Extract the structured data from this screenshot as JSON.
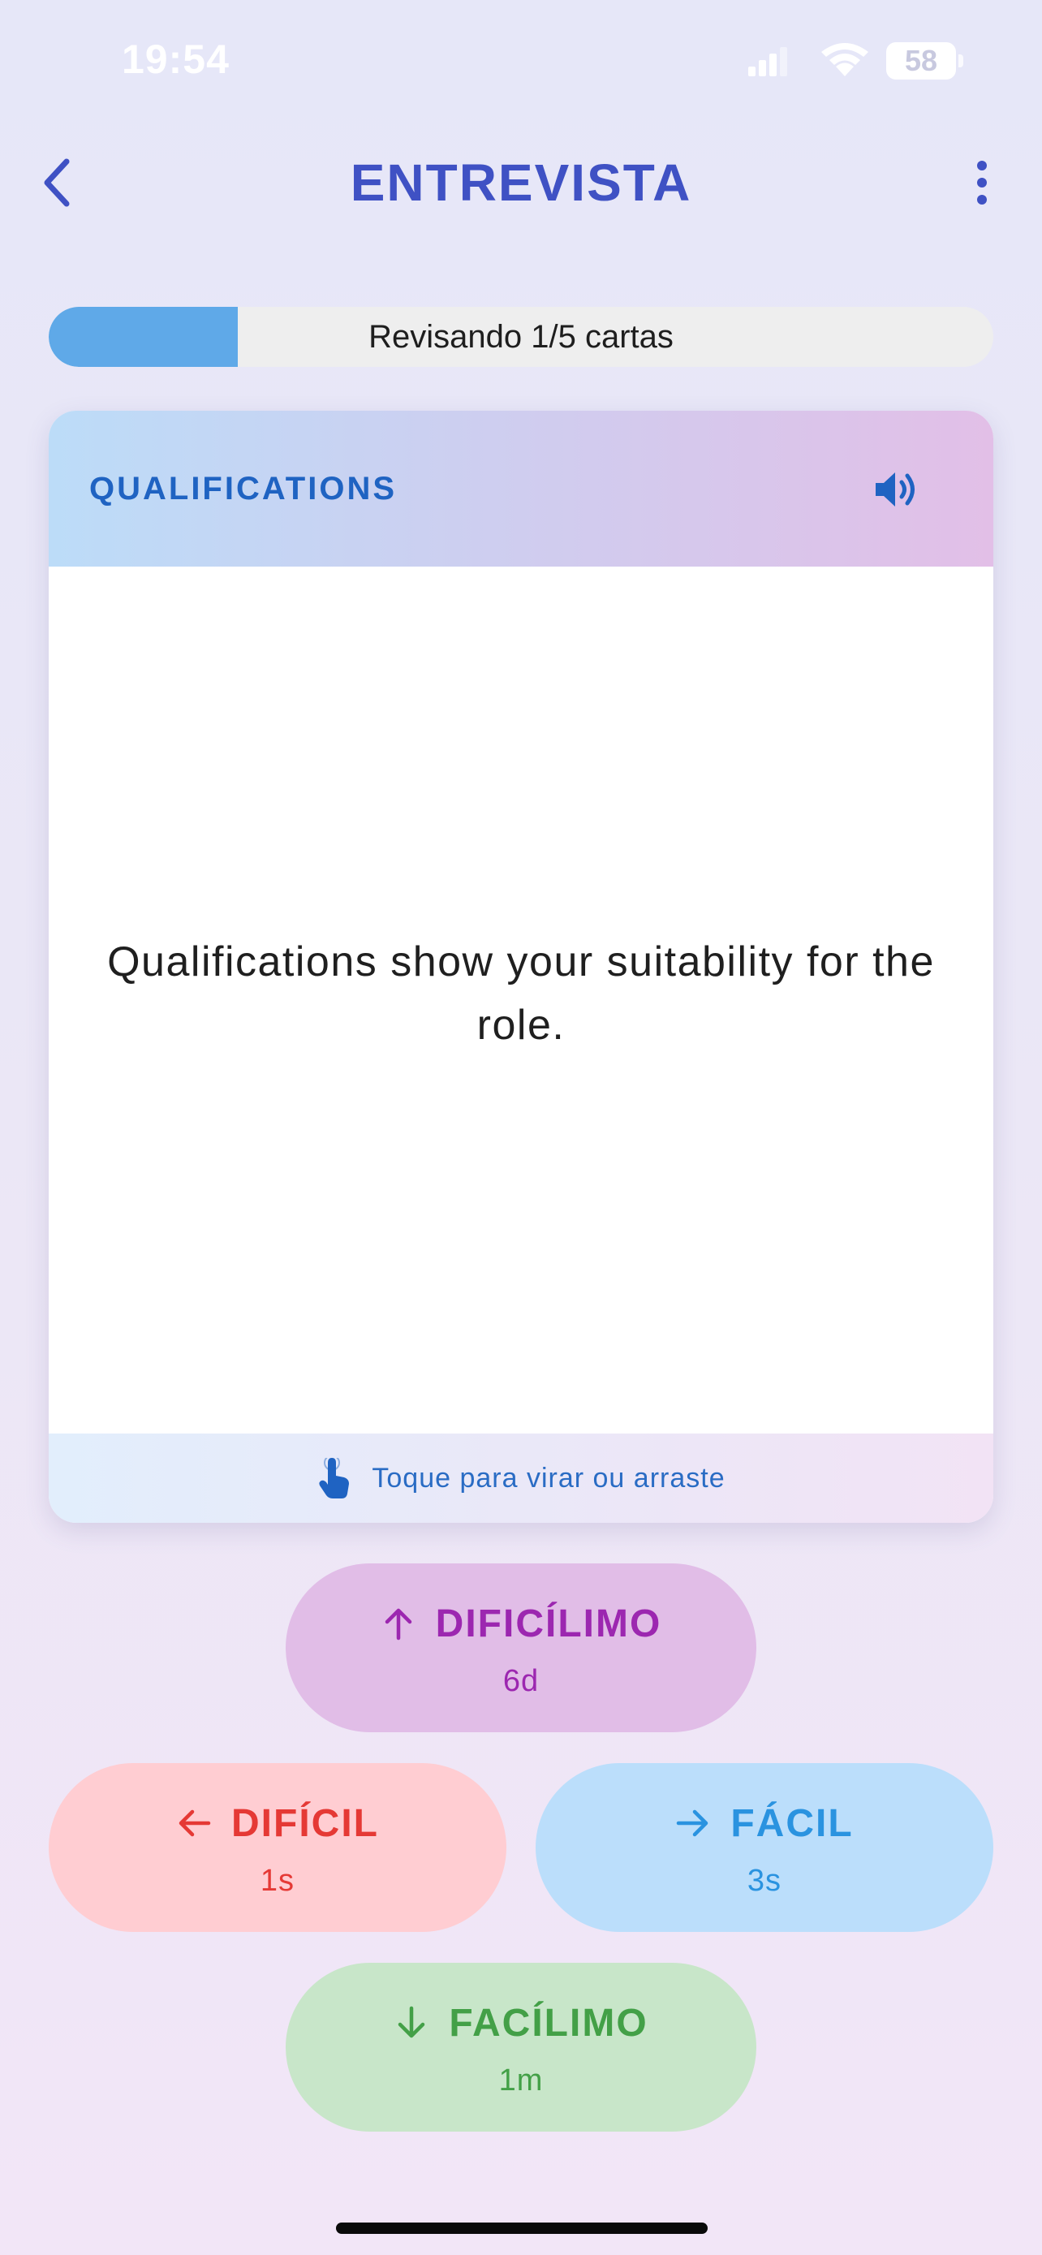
{
  "status_bar": {
    "time": "19:54",
    "battery_level": "58"
  },
  "header": {
    "title": "ENTREVISTA",
    "back_icon": "chevron-left-icon",
    "more_icon": "more-vertical-icon"
  },
  "progress": {
    "label": "Revisando 1/5 cartas",
    "fraction": 0.2
  },
  "card": {
    "category": "QUALIFICATIONS",
    "text": "Qualifications show your suitability for the role.",
    "hint": "Toque para virar ou arraste",
    "speaker_icon": "speaker-icon",
    "hint_icon": "tap-hand-icon"
  },
  "answers": {
    "dificilimo": {
      "label": "DIFICÍLIMO",
      "interval": "6d",
      "arrow": "arrow-up-icon"
    },
    "dificil": {
      "label": "DIFÍCIL",
      "interval": "1s",
      "arrow": "arrow-left-icon"
    },
    "facil": {
      "label": "FÁCIL",
      "interval": "3s",
      "arrow": "arrow-right-icon"
    },
    "facilimo": {
      "label": "FACÍLIMO",
      "interval": "1m",
      "arrow": "arrow-down-icon"
    }
  },
  "colors": {
    "title": "#3f51c4",
    "progress_fill": "#5fa9e8",
    "category": "#1f63c2",
    "dificilimo": "#9c27b0",
    "dificil": "#e53935",
    "facil": "#2a93e0",
    "facilimo": "#43a047"
  }
}
